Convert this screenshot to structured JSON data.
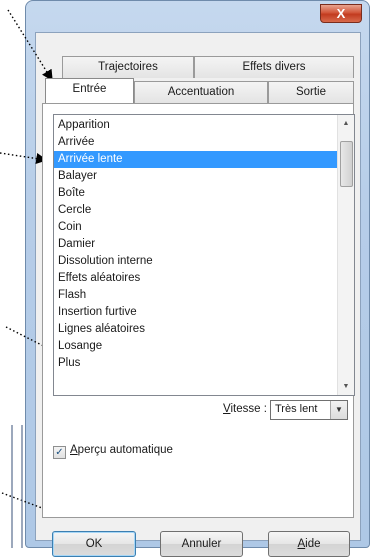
{
  "window": {
    "close_label": "X"
  },
  "tabs": {
    "row1": [
      {
        "label": "Trajectoires"
      },
      {
        "label": "Effets divers"
      }
    ],
    "row2": [
      {
        "label": "Entrée"
      },
      {
        "label": "Accentuation"
      },
      {
        "label": "Sortie"
      }
    ],
    "active": "Entrée"
  },
  "effects_list": {
    "items": [
      "Apparition",
      "Arrivée",
      "Arrivée lente",
      "Balayer",
      "Boîte",
      "Cercle",
      "Coin",
      "Damier",
      "Dissolution interne",
      "Effets aléatoires",
      "Flash",
      "Insertion furtive",
      "Lignes aléatoires",
      "Losange",
      "Plus"
    ],
    "selected": "Arrivée lente"
  },
  "speed": {
    "label_accel": "V",
    "label_rest": "itesse :",
    "value": "Très lent"
  },
  "preview": {
    "accel": "A",
    "rest": "perçu automatique",
    "checked": true
  },
  "buttons": {
    "ok": "OK",
    "cancel": "Annuler",
    "help_accel": "A",
    "help_rest": "ide"
  },
  "icons": {
    "close": "close-icon",
    "scroll_up": "chevron-up-icon",
    "scroll_down": "chevron-down-icon",
    "dropdown": "chevron-down-icon",
    "check": "check-icon"
  }
}
